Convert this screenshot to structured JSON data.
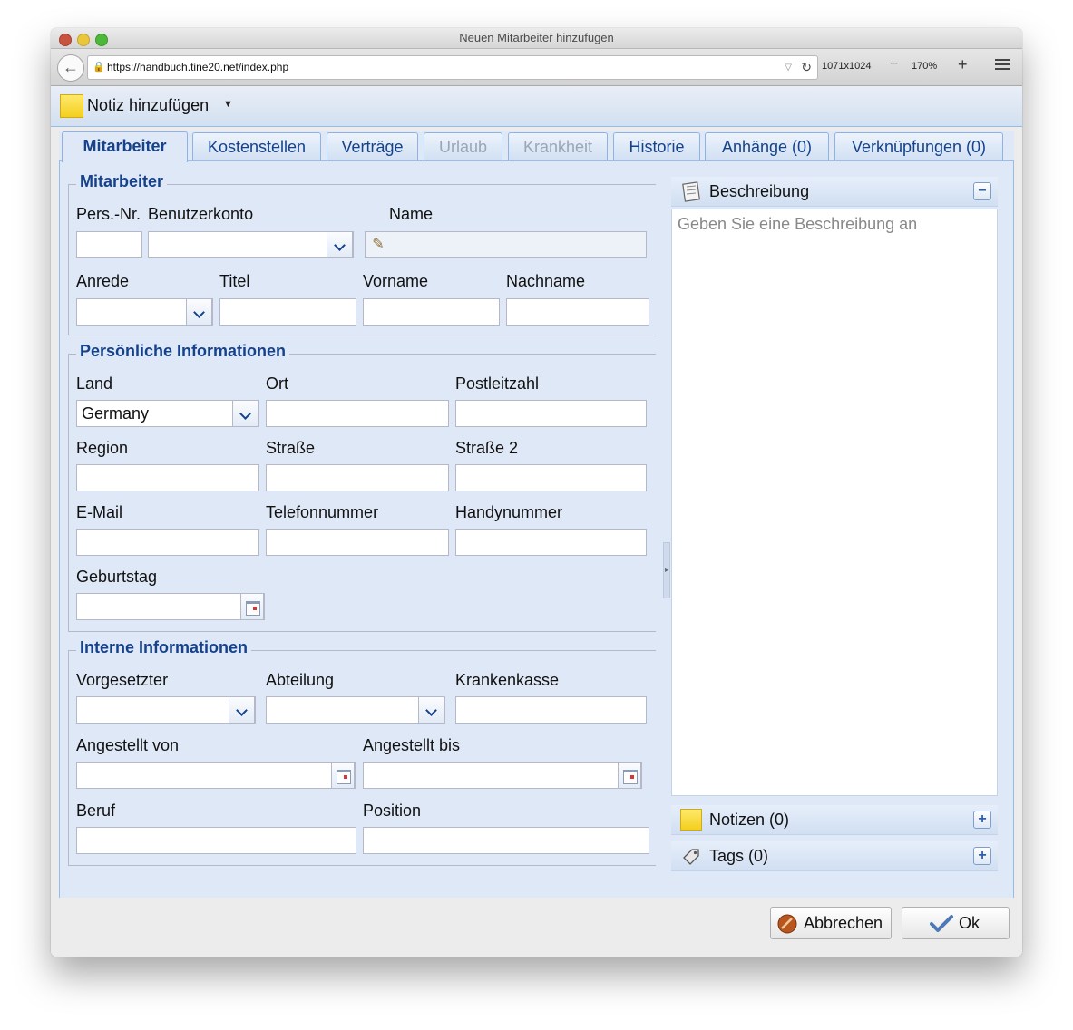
{
  "window": {
    "title": "Neuen Mitarbeiter hinzufügen"
  },
  "browser": {
    "url": "https://handbuch.tine20.net/index.php",
    "resolution": "1071x1024",
    "zoom": "170%"
  },
  "toolbar": {
    "note_label": "Notiz hinzufügen"
  },
  "tabs": [
    {
      "label": "Mitarbeiter",
      "active": true,
      "disabled": false
    },
    {
      "label": "Kostenstellen",
      "active": false,
      "disabled": false
    },
    {
      "label": "Verträge",
      "active": false,
      "disabled": false
    },
    {
      "label": "Urlaub",
      "active": false,
      "disabled": true
    },
    {
      "label": "Krankheit",
      "active": false,
      "disabled": true
    },
    {
      "label": "Historie",
      "active": false,
      "disabled": false
    },
    {
      "label": "Anhänge (0)",
      "active": false,
      "disabled": false
    },
    {
      "label": "Verknüpfungen (0)",
      "active": false,
      "disabled": false
    }
  ],
  "sections": {
    "mitarbeiter": {
      "legend": "Mitarbeiter",
      "pers_nr_label": "Pers.-Nr.",
      "account_label": "Benutzerkonto",
      "name_label": "Name",
      "salutation_label": "Anrede",
      "title_label": "Titel",
      "firstname_label": "Vorname",
      "lastname_label": "Nachname"
    },
    "personal": {
      "legend": "Persönliche Informationen",
      "country_label": "Land",
      "country_value": "Germany",
      "city_label": "Ort",
      "zip_label": "Postleitzahl",
      "region_label": "Region",
      "street_label": "Straße",
      "street2_label": "Straße 2",
      "email_label": "E-Mail",
      "phone_label": "Telefonnummer",
      "mobile_label": "Handynummer",
      "birthday_label": "Geburtstag"
    },
    "internal": {
      "legend": "Interne Informationen",
      "supervisor_label": "Vorgesetzter",
      "department_label": "Abteilung",
      "insurance_label": "Krankenkasse",
      "employed_from_label": "Angestellt von",
      "employed_until_label": "Angestellt bis",
      "profession_label": "Beruf",
      "position_label": "Position"
    }
  },
  "sidebar": {
    "description_title": "Beschreibung",
    "description_placeholder": "Geben Sie eine Beschreibung an",
    "notes_title": "Notizen (0)",
    "tags_title": "Tags (0)"
  },
  "footer": {
    "cancel_label": "Abbrechen",
    "ok_label": "Ok"
  }
}
